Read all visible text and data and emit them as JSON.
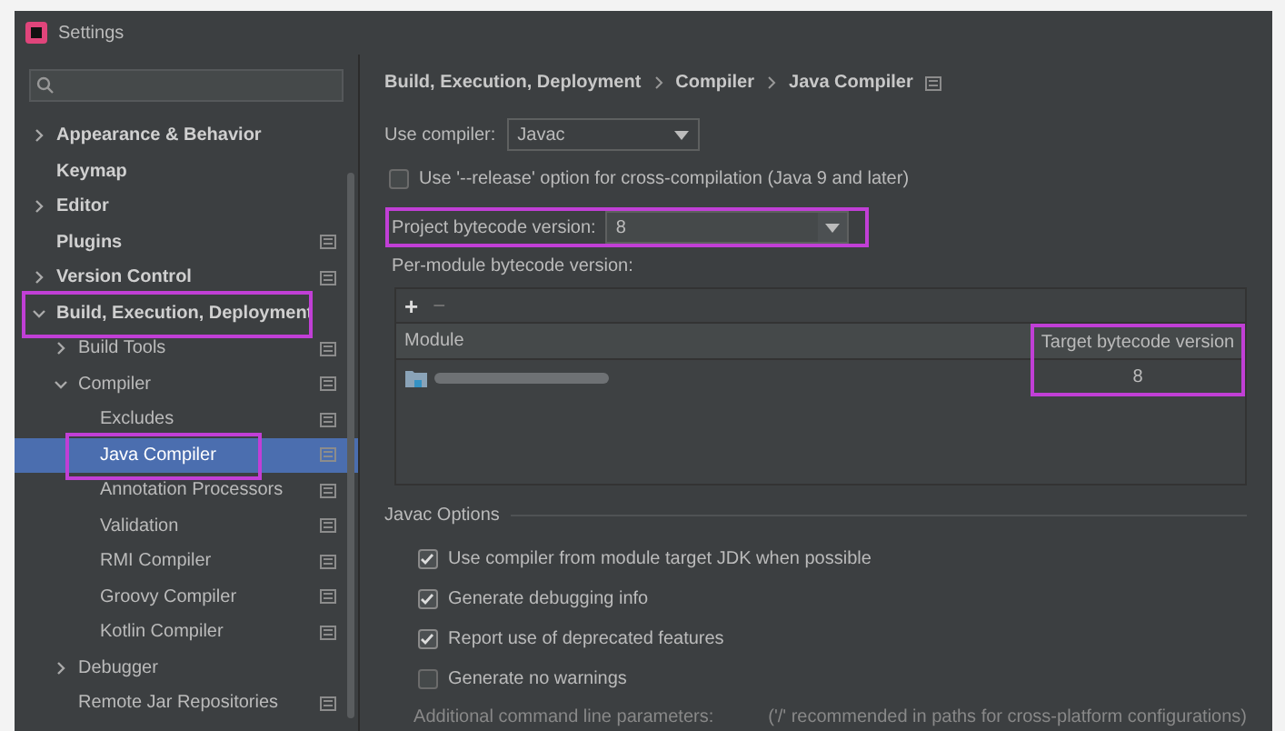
{
  "window": {
    "title": "Settings"
  },
  "sidebar": {
    "items": [
      {
        "label": "Appearance & Behavior",
        "expanded": false,
        "selected": false
      },
      {
        "label": "Keymap",
        "selected": false
      },
      {
        "label": "Editor",
        "expanded": false,
        "selected": false
      },
      {
        "label": "Plugins",
        "selected": false,
        "project_icon": true
      },
      {
        "label": "Version Control",
        "expanded": false,
        "selected": false,
        "project_icon": true
      },
      {
        "label": "Build, Execution, Deployment",
        "expanded": true,
        "selected": false,
        "highlight": true,
        "children": [
          {
            "label": "Build Tools",
            "expanded": false,
            "selected": false,
            "project_icon": true
          },
          {
            "label": "Compiler",
            "expanded": true,
            "selected": false,
            "project_icon": true,
            "children": [
              {
                "label": "Excludes",
                "selected": false,
                "project_icon": true
              },
              {
                "label": "Java Compiler",
                "selected": true,
                "highlight": true,
                "project_icon": true
              },
              {
                "label": "Annotation Processors",
                "selected": false,
                "project_icon": true
              },
              {
                "label": "Validation",
                "selected": false,
                "project_icon": true
              },
              {
                "label": "RMI Compiler",
                "selected": false,
                "project_icon": true
              },
              {
                "label": "Groovy Compiler",
                "selected": false,
                "project_icon": true
              },
              {
                "label": "Kotlin Compiler",
                "selected": false,
                "project_icon": true
              }
            ]
          },
          {
            "label": "Debugger",
            "expanded": false,
            "selected": false
          },
          {
            "label": "Remote Jar Repositories",
            "selected": false,
            "project_icon": true
          }
        ]
      }
    ]
  },
  "breadcrumb": [
    "Build, Execution, Deployment",
    "Compiler",
    "Java Compiler"
  ],
  "use_compiler": {
    "label": "Use compiler:",
    "value": "Javac"
  },
  "release_option": {
    "label": "Use '--release' option for cross-compilation (Java 9 and later)",
    "checked": false
  },
  "project_bytecode": {
    "label": "Project bytecode version:",
    "value": "8",
    "highlight": true
  },
  "per_module": {
    "label": "Per-module bytecode version:",
    "add": "+",
    "remove": "−",
    "table": {
      "columns": [
        {
          "label": "Module",
          "highlight": false
        },
        {
          "label": "Target bytecode version",
          "highlight": true
        }
      ],
      "rows": [
        {
          "target": "8"
        }
      ]
    }
  },
  "javac_options": {
    "title": "Javac Options",
    "options": [
      {
        "label": "Use compiler from module target JDK when possible",
        "checked": true
      },
      {
        "label": "Generate debugging info",
        "checked": true
      },
      {
        "label": "Report use of deprecated features",
        "checked": true
      },
      {
        "label": "Generate no warnings",
        "checked": false
      }
    ],
    "additional": {
      "label": "Additional command line parameters:",
      "hint": "('/' recommended in paths for cross-platform configurations)"
    }
  }
}
